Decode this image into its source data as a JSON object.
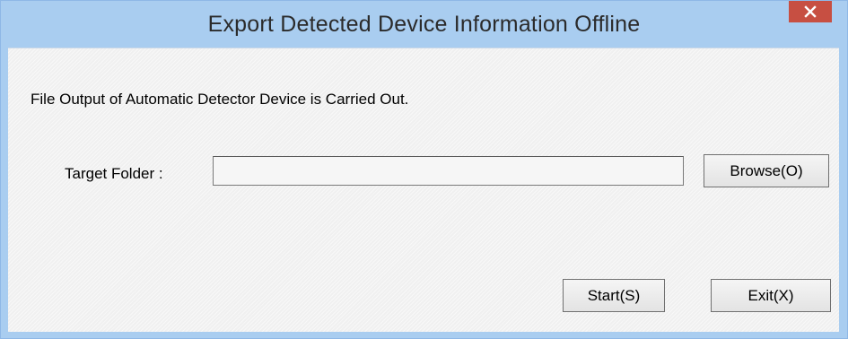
{
  "window": {
    "title": "Export Detected Device Information Offline",
    "close_icon": "close-icon"
  },
  "dialog": {
    "message": "File Output of Automatic Detector Device is Carried Out.",
    "target_folder": {
      "label": "Target Folder  :",
      "value": "",
      "placeholder": ""
    },
    "buttons": {
      "browse": "Browse(O)",
      "start": "Start(S)",
      "exit": "Exit(X)"
    }
  },
  "colors": {
    "titlebar": "#a9cdf0",
    "close_button": "#c74f42",
    "client_background": "#f0f0f0"
  }
}
